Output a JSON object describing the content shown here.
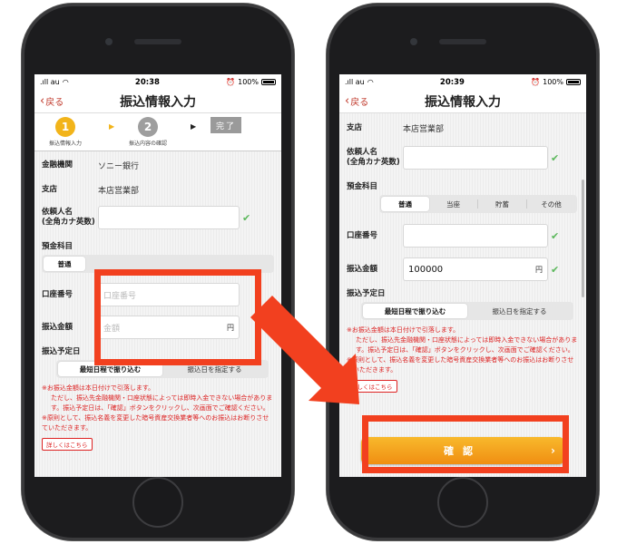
{
  "left": {
    "status": {
      "carrier": ".ıll au",
      "time": "20:38",
      "battery": "100%"
    },
    "nav": {
      "back": "戻る",
      "title": "振込情報入力"
    },
    "steps": {
      "s1_num": "1",
      "s1_label": "振込情報入力",
      "s2_num": "2",
      "s2_label": "振込内容の確認",
      "done": "完了"
    },
    "bank_label": "金融機関",
    "bank_value": "ソニー銀行",
    "branch_label": "支店",
    "branch_value": "本店営業部",
    "name_label": "依頼人名\n(全角カナ英数)",
    "account_type_label": "預金科目",
    "account_type_first": "普通",
    "account_label": "口座番号",
    "account_placeholder": "口座番号",
    "amount_label": "振込金額",
    "amount_placeholder": "金額",
    "amount_unit": "円",
    "date_label": "振込予定日",
    "date_opt1": "最短日程で振り込む",
    "date_opt2": "振込日を指定する",
    "notes": [
      "※お振込金額は本日付けで引落します。",
      "ただし、振込先金融機関・口座状態によっては即時入金できない場合があります。振込予定日は、「確認」ボタンをクリックし、次画面でご確認ください。",
      "※原則として、振込名義を変更した暗号資産交換業者等へのお振込はお断りさせていただきます。"
    ],
    "more_link": "詳しくはこちら"
  },
  "right": {
    "status": {
      "carrier": ".ıll au",
      "time": "20:39",
      "battery": "100%"
    },
    "nav": {
      "back": "戻る",
      "title": "振込情報入力"
    },
    "branch_label": "支店",
    "branch_value": "本店営業部",
    "name_label": "依頼人名\n(全角カナ英数)",
    "account_type_label": "預金科目",
    "account_types": [
      "普通",
      "当座",
      "貯蓄",
      "その他"
    ],
    "account_label": "口座番号",
    "amount_label": "振込金額",
    "amount_value": "100000",
    "amount_unit": "円",
    "date_label": "振込予定日",
    "date_opt1": "最短日程で振り込む",
    "date_opt2": "振込日を指定する",
    "notes": [
      "※お振込金額は本日付けで引落します。",
      "ただし、振込先金融機関・口座状態によっては即時入金できない場合があります。振込予定日は、「確認」ボタンをクリックし、次画面でご確認ください。",
      "※原則として、振込名義を変更した暗号資産交換業者等へのお振込はお断りさせていただきます。"
    ],
    "more_link": "詳しくはこちら",
    "confirm": "確認",
    "confirm_arrow": "›"
  },
  "colors": {
    "highlight": "#f2401f",
    "accent": "#f2b41a",
    "back_link": "#c0392b",
    "note_text": "#dd2222",
    "check": "#5cb85c"
  },
  "icons": [
    "wifi-icon",
    "alarm-icon",
    "battery-icon",
    "back-chevron-icon",
    "checkmark-icon",
    "step-arrow-icon"
  ]
}
